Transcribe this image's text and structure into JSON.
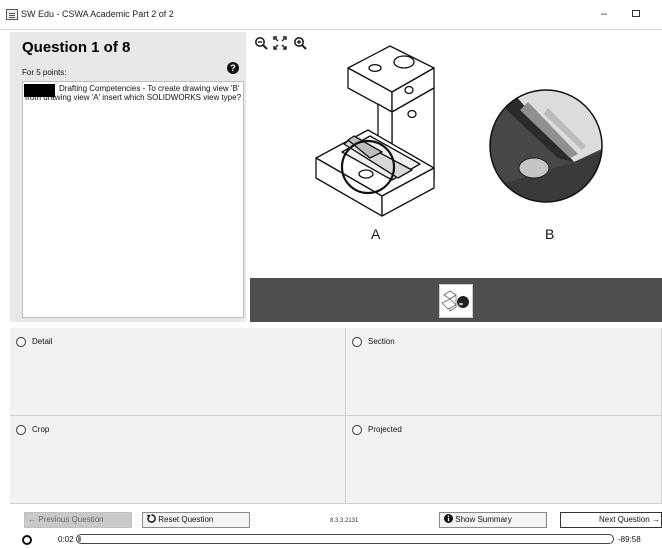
{
  "window": {
    "title": "SW Edu - CSWA Academic Part 2 of 2",
    "minimize_glyph": "–"
  },
  "question": {
    "title": "Question 1 of 8",
    "points": "For 5 points:",
    "text": "Drafting Competencies - To create drawing view 'B' from drawing view 'A' insert which SOLIDWORKS view type?",
    "help_icon": "?"
  },
  "viewer": {
    "tools": [
      "zoom-out-icon",
      "fit-icon",
      "zoom-in-icon"
    ],
    "label_a": "A",
    "label_b": "B"
  },
  "answers": [
    {
      "label": "Detail"
    },
    {
      "label": "Section"
    },
    {
      "label": "Crop"
    },
    {
      "label": "Projected"
    }
  ],
  "footer": {
    "prev_label": "Previous Question",
    "reset_label": "Reset Question",
    "version": "8.3.3.2131",
    "summary_label": "Show Summary",
    "next_label": "Next Question",
    "elapsed": "0:02",
    "remaining": "-89:58",
    "progress_fraction": 0.003
  }
}
